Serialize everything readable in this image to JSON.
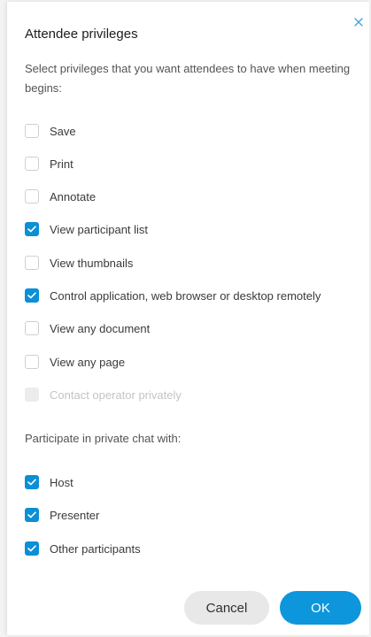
{
  "dialog": {
    "title": "Attendee privileges",
    "description": "Select privileges that you want attendees to have when meeting begins:",
    "close_icon": "close-icon"
  },
  "privileges": [
    {
      "label": "Save",
      "checked": false,
      "disabled": false
    },
    {
      "label": "Print",
      "checked": false,
      "disabled": false
    },
    {
      "label": "Annotate",
      "checked": false,
      "disabled": false
    },
    {
      "label": "View participant list",
      "checked": true,
      "disabled": false
    },
    {
      "label": "View thumbnails",
      "checked": false,
      "disabled": false
    },
    {
      "label": "Control application, web browser or desktop remotely",
      "checked": true,
      "disabled": false
    },
    {
      "label": "View any document",
      "checked": false,
      "disabled": false
    },
    {
      "label": "View any page",
      "checked": false,
      "disabled": false
    },
    {
      "label": "Contact operator privately",
      "checked": false,
      "disabled": true
    }
  ],
  "chat": {
    "section_label": "Participate in private chat with:",
    "options": [
      {
        "label": "Host",
        "checked": true,
        "disabled": false
      },
      {
        "label": "Presenter",
        "checked": true,
        "disabled": false
      },
      {
        "label": "Other participants",
        "checked": true,
        "disabled": false
      }
    ]
  },
  "buttons": {
    "cancel_label": "Cancel",
    "ok_label": "OK"
  },
  "colors": {
    "accent": "#0b8fd6",
    "ok_button": "#0d96dc",
    "cancel_button": "#e8e8e8",
    "disabled": "#ececec"
  }
}
